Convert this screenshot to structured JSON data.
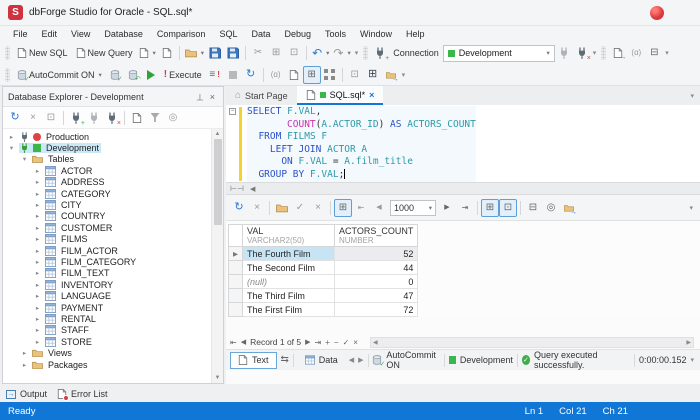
{
  "titlebar": {
    "title": "dbForge Studio for Oracle - SQL.sql*",
    "logo_text": "S"
  },
  "menubar": {
    "items": [
      "File",
      "Edit",
      "View",
      "Database",
      "Comparison",
      "SQL",
      "Data",
      "Debug",
      "Tools",
      "Window",
      "Help"
    ]
  },
  "toolbar_standard": {
    "new_sql": "New SQL",
    "new_query": "New Query",
    "connection_label": "Connection",
    "connection_value": "Development"
  },
  "toolbar_execute": {
    "autocommit": "AutoCommit ON",
    "execute": "Execute"
  },
  "explorer": {
    "title": "Database Explorer - Development",
    "tree": [
      {
        "label": "Production",
        "level": 0,
        "icon": "plug",
        "plug_color": "#5f6b76",
        "status": "red-circle",
        "expand": "collapsed"
      },
      {
        "label": "Development",
        "level": 0,
        "icon": "plug",
        "plug_color": "#3a9e3a",
        "status": "green-square",
        "expand": "expanded",
        "selected": true
      },
      {
        "label": "Tables",
        "level": 1,
        "icon": "folder",
        "expand": "expanded"
      },
      {
        "label": "ACTOR",
        "level": 2,
        "icon": "table",
        "expand": "collapsed"
      },
      {
        "label": "ADDRESS",
        "level": 2,
        "icon": "table",
        "expand": "collapsed"
      },
      {
        "label": "CATEGORY",
        "level": 2,
        "icon": "table",
        "expand": "collapsed"
      },
      {
        "label": "CITY",
        "level": 2,
        "icon": "table",
        "expand": "collapsed"
      },
      {
        "label": "COUNTRY",
        "level": 2,
        "icon": "table",
        "expand": "collapsed"
      },
      {
        "label": "CUSTOMER",
        "level": 2,
        "icon": "table",
        "expand": "collapsed"
      },
      {
        "label": "FILMS",
        "level": 2,
        "icon": "table",
        "expand": "collapsed"
      },
      {
        "label": "FILM_ACTOR",
        "level": 2,
        "icon": "table",
        "expand": "collapsed"
      },
      {
        "label": "FILM_CATEGORY",
        "level": 2,
        "icon": "table",
        "expand": "collapsed"
      },
      {
        "label": "FILM_TEXT",
        "level": 2,
        "icon": "table",
        "expand": "collapsed"
      },
      {
        "label": "INVENTORY",
        "level": 2,
        "icon": "table",
        "expand": "collapsed"
      },
      {
        "label": "LANGUAGE",
        "level": 2,
        "icon": "table",
        "expand": "collapsed"
      },
      {
        "label": "PAYMENT",
        "level": 2,
        "icon": "table",
        "expand": "collapsed"
      },
      {
        "label": "RENTAL",
        "level": 2,
        "icon": "table",
        "expand": "collapsed"
      },
      {
        "label": "STAFF",
        "level": 2,
        "icon": "table",
        "expand": "collapsed"
      },
      {
        "label": "STORE",
        "level": 2,
        "icon": "table",
        "expand": "collapsed"
      },
      {
        "label": "Views",
        "level": 1,
        "icon": "folder",
        "expand": "collapsed"
      },
      {
        "label": "Packages",
        "level": 1,
        "icon": "folder",
        "expand": "collapsed"
      }
    ]
  },
  "doc_tabs": {
    "start_page": "Start Page",
    "sql_tab": "SQL.sql*"
  },
  "editor": {
    "lines": [
      [
        {
          "t": "SELECT",
          "c": "kw"
        },
        {
          "t": " ",
          "c": "pl"
        },
        {
          "t": "F.VAL",
          "c": "id"
        },
        {
          "t": ",",
          "c": "pl"
        }
      ],
      [
        {
          "t": "       ",
          "c": "pl"
        },
        {
          "t": "COUNT",
          "c": "fn"
        },
        {
          "t": "(",
          "c": "pl"
        },
        {
          "t": "A.ACTOR_ID",
          "c": "id"
        },
        {
          "t": ") ",
          "c": "pl"
        },
        {
          "t": "AS",
          "c": "kw"
        },
        {
          "t": " ",
          "c": "pl"
        },
        {
          "t": "ACTORS_COUNT",
          "c": "id"
        }
      ],
      [
        {
          "t": "  ",
          "c": "pl"
        },
        {
          "t": "FROM",
          "c": "kw"
        },
        {
          "t": " ",
          "c": "pl"
        },
        {
          "t": "FILMS F",
          "c": "id"
        }
      ],
      [
        {
          "t": "    ",
          "c": "pl"
        },
        {
          "t": "LEFT JOIN",
          "c": "kw"
        },
        {
          "t": " ",
          "c": "pl"
        },
        {
          "t": "ACTOR A",
          "c": "id"
        }
      ],
      [
        {
          "t": "      ",
          "c": "pl"
        },
        {
          "t": "ON",
          "c": "kw"
        },
        {
          "t": " ",
          "c": "pl"
        },
        {
          "t": "F.VAL",
          "c": "id"
        },
        {
          "t": " = ",
          "c": "pl"
        },
        {
          "t": "A.film_title",
          "c": "id"
        }
      ],
      [
        {
          "t": "  ",
          "c": "pl"
        },
        {
          "t": "GROUP BY",
          "c": "kw"
        },
        {
          "t": " ",
          "c": "pl"
        },
        {
          "t": "F.VAL",
          "c": "id"
        },
        {
          "t": ";",
          "c": "pl"
        }
      ]
    ]
  },
  "results": {
    "fetch_size": "1000",
    "columns": [
      {
        "name": "VAL",
        "type": "VARCHAR2(50)"
      },
      {
        "name": "ACTORS_COUNT",
        "type": "NUMBER"
      }
    ],
    "rows": [
      {
        "val": "The Fourth Film",
        "count": "52"
      },
      {
        "val": "The Second Film",
        "count": "44"
      },
      {
        "val": "(null)",
        "count": "0",
        "is_null": true
      },
      {
        "val": "The Third Film",
        "count": "47"
      },
      {
        "val": "The First Film",
        "count": "72"
      }
    ],
    "record_status": "Record 1 of 5"
  },
  "doc_footer": {
    "text_tab": "Text",
    "data_tab": "Data",
    "autocommit": "AutoCommit ON",
    "connection": "Development",
    "message": "Query executed successfully.",
    "duration": "0:00:00.152"
  },
  "panel_tabs": {
    "output": "Output",
    "error_list": "Error List"
  },
  "statusbar": {
    "state": "Ready",
    "line": "Ln 1",
    "col": "Col 21",
    "ch": "Ch 21"
  },
  "icons": {
    "collapsed": "▸",
    "expanded": "▾",
    "dropdown": "▾",
    "overflow": "▾",
    "refresh": "↻",
    "undo": "↶",
    "redo": "↷",
    "close": "×",
    "check": "✓",
    "cut": "✂",
    "pin": "⊤",
    "home": "⌂",
    "first": "⇤",
    "last": "⇥",
    "prev": "◀",
    "next": "▶",
    "up": "▲",
    "down": "▼",
    "plus": "+",
    "minus": "−",
    "script": "≡",
    "alpha": "(ɑ)",
    "swap": "⇆",
    "splith": "⊢⊣",
    "gridbox": "⊞",
    "cardbox": "⊡",
    "colhead": "⊟",
    "search": "◎",
    "export": "⇥",
    "arrow_out": "→"
  },
  "colors": {
    "accent_blue": "#1177d7",
    "status_green": "#3cb54a",
    "status_red": "#e04040",
    "keyword": "#2b51c8",
    "function": "#cc2fae",
    "identifier": "#2b9aa8",
    "modified_line_bar": "#f2d42c",
    "selection": "#cbe8f6"
  }
}
